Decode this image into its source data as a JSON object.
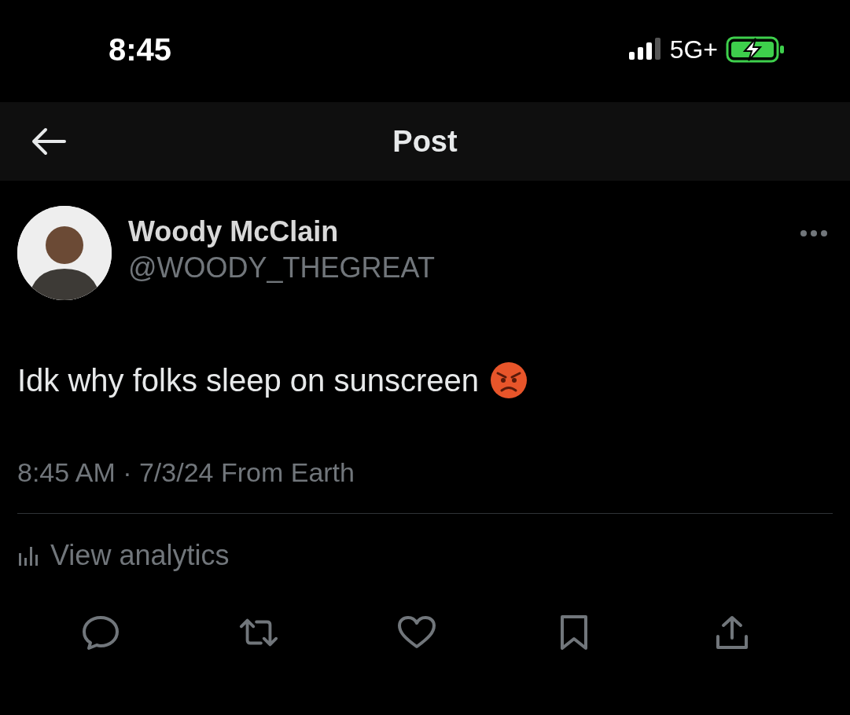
{
  "status_bar": {
    "time": "8:45",
    "network": "5G+",
    "battery": {
      "charging": true
    }
  },
  "header": {
    "title": "Post"
  },
  "post": {
    "author": {
      "name": "Woody McClain",
      "handle": "@WOODY_THEGREAT"
    },
    "text": "Idk why folks sleep on sunscreen",
    "meta": "8:45 AM · 7/3/24 From Earth",
    "analytics": "View analytics"
  }
}
